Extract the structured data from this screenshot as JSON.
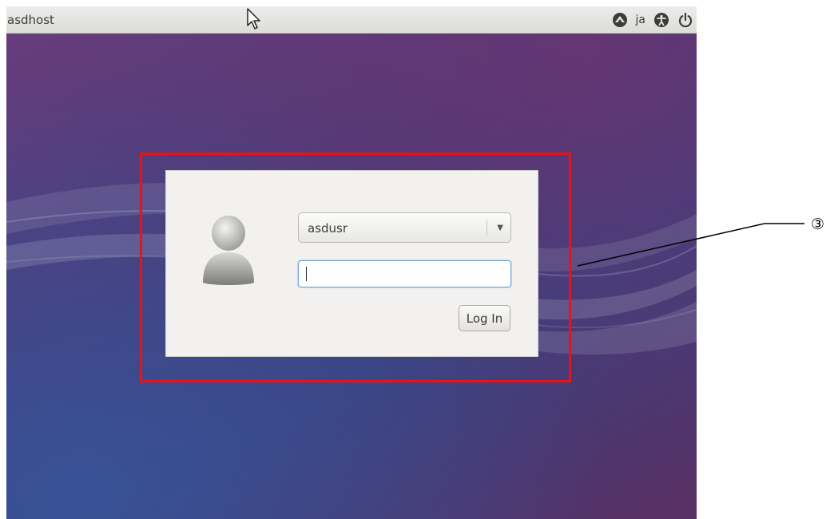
{
  "topbar": {
    "hostname": "asdhost",
    "language": "ja",
    "icons": [
      "network-icon",
      "accessibility-icon",
      "power-icon"
    ]
  },
  "login_dialog": {
    "username": "asdusr",
    "password_value": "",
    "login_button_label": "Log In"
  },
  "annotation": {
    "number": "③",
    "highlight_color": "#e5141a"
  },
  "colors": {
    "background_purple": "#4b3a78",
    "dialog_background": "#f2f1f0",
    "focus_border": "#75a7d5"
  }
}
